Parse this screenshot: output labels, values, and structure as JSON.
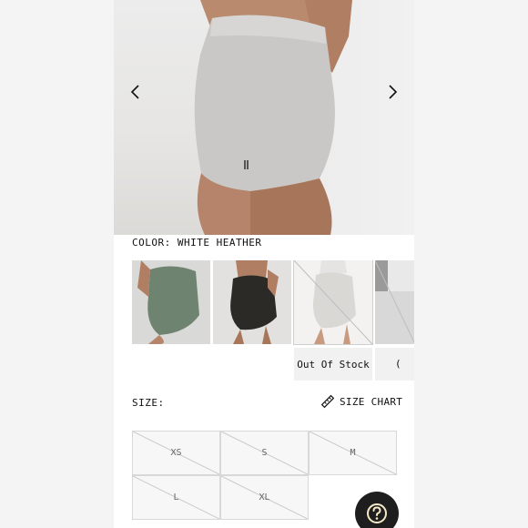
{
  "product": {
    "color_prefix": "COLOR:",
    "color_name": "WHITE HEATHER",
    "swatches": [
      {
        "name": "green heather",
        "color": "#6f8470"
      },
      {
        "name": "black",
        "color": "#2b2a27"
      },
      {
        "name": "white heather",
        "color": "#e8e6e2",
        "stock_note": "Out Of Stock"
      },
      {
        "name": "partial",
        "color": "#d5d5d5",
        "stock_note": "("
      }
    ]
  },
  "sizes": {
    "label": "SIZE:",
    "chart_label": "SIZE CHART",
    "options": [
      "XS",
      "S",
      "M",
      "L",
      "XL"
    ]
  },
  "icons": {
    "prev": "chevron-left-icon",
    "next": "chevron-right-icon",
    "ruler": "ruler-icon",
    "help": "question-mark-icon"
  },
  "colors": {
    "help_bg": "#1e1e1e",
    "size_cell_bg": "#f7f7f7",
    "text": "#111111"
  }
}
